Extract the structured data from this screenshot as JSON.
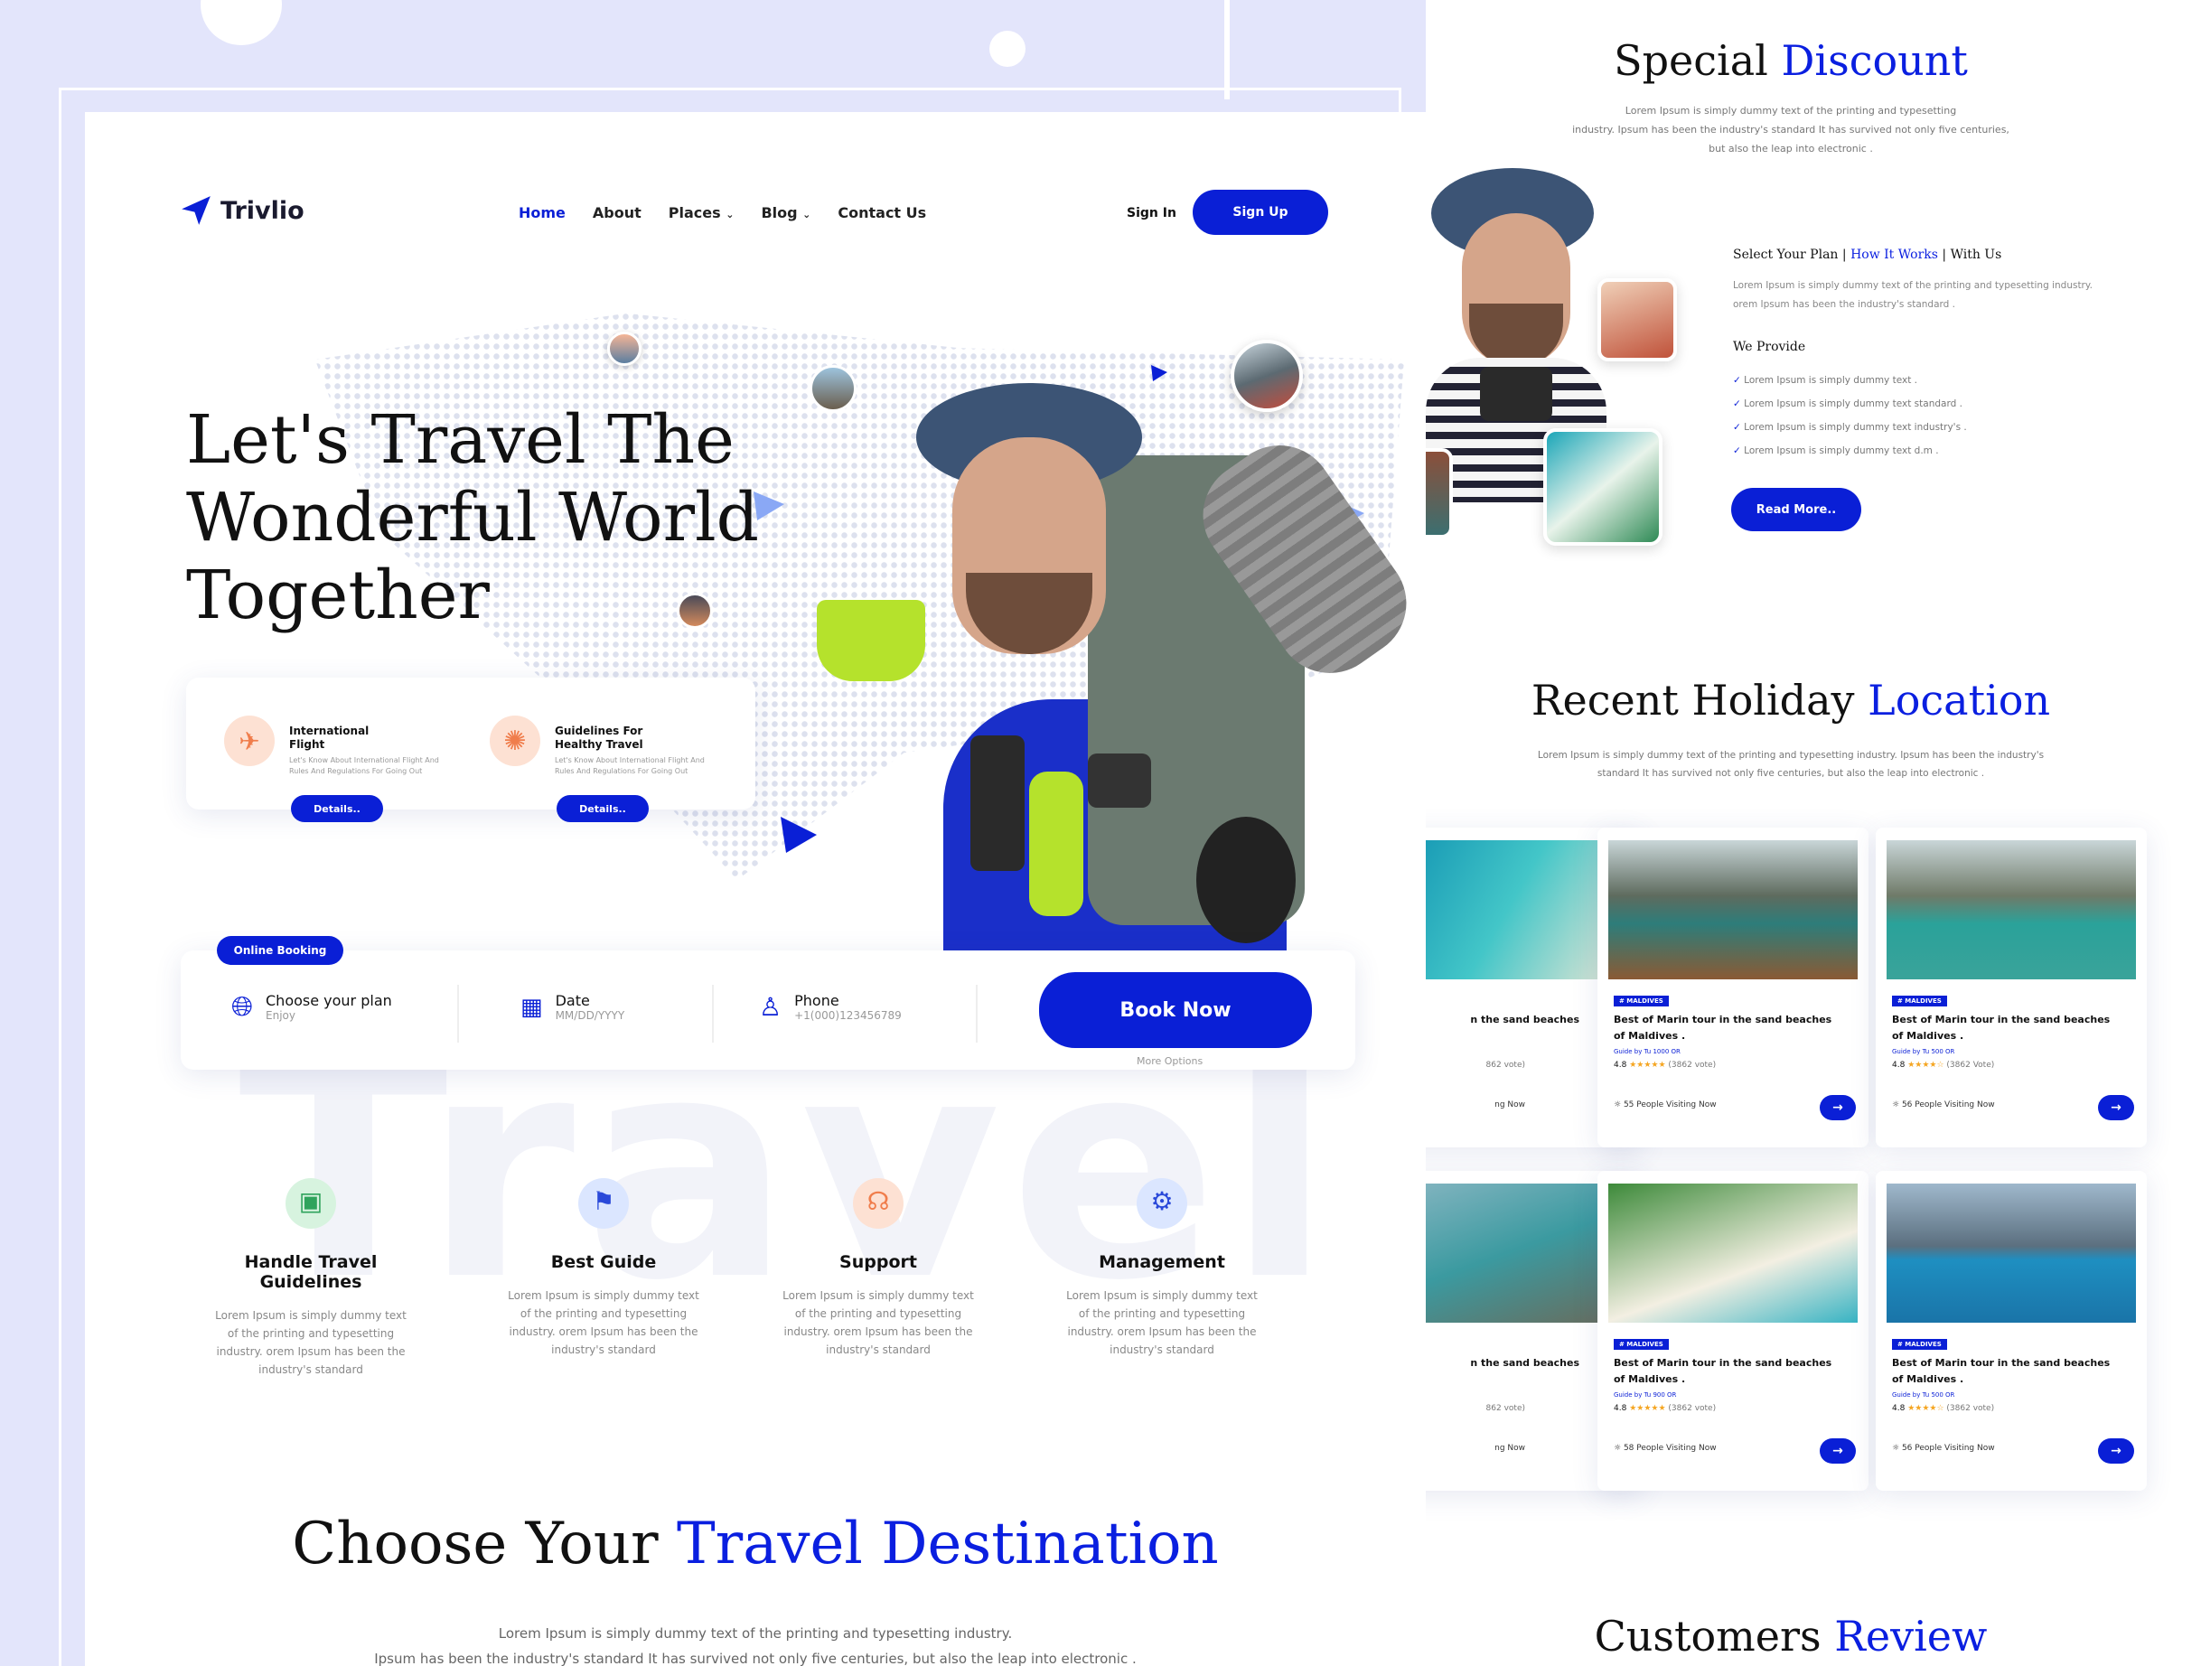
{
  "colors": {
    "accent": "#0a1fd6",
    "background": "#e3e5fb"
  },
  "header": {
    "logo_text": "Trivlio",
    "nav": [
      "Home",
      "About",
      "Places",
      "Blog",
      "Contact Us"
    ],
    "sign_in": "Sign In",
    "sign_up": "Sign Up"
  },
  "hero": {
    "title_1": "Let's Travel The",
    "title_2": "Wonderful World",
    "title_3": "Together",
    "features": [
      {
        "title_1": "International",
        "title_2": "Flight",
        "desc": "Let's Know About International Flight And Rules And Regulations For Going Out",
        "button": "Details.."
      },
      {
        "title_1": "Guidelines For",
        "title_2": "Healthy Travel",
        "desc": "Let's Know About International Flight And Rules And Regulations For Going Out",
        "button": "Details.."
      }
    ]
  },
  "booking": {
    "tag": "Online Booking",
    "plan_label": "Choose your plan",
    "plan_value": "Enjoy",
    "date_label": "Date",
    "date_value": "MM/DD/YYYY",
    "phone_label": "Phone",
    "phone_value": "+1(000)123456789",
    "book_button": "Book Now",
    "more": "More Options"
  },
  "watermark": "Travel",
  "services": [
    {
      "title": "Handle Travel Guidelines",
      "icon": "map-guide-icon",
      "l1": "Lorem Ipsum is simply dummy text",
      "l2": "of the printing and typesetting",
      "l3": "industry. orem Ipsum has been the",
      "l4": "industry's standard"
    },
    {
      "title": "Best Guide",
      "icon": "guide-icon",
      "l1": "Lorem Ipsum is simply dummy text",
      "l2": "of the printing and typesetting",
      "l3": "industry. orem Ipsum has been the",
      "l4": "industry's standard"
    },
    {
      "title": "Support",
      "icon": "headset-icon",
      "l1": "Lorem Ipsum is simply dummy text",
      "l2": "of the printing and typesetting",
      "l3": "industry. orem Ipsum has been the",
      "l4": "industry's standard"
    },
    {
      "title": "Management",
      "icon": "management-icon",
      "l1": "Lorem Ipsum is simply dummy text",
      "l2": "of the printing and typesetting",
      "l3": "industry. orem Ipsum has been the",
      "l4": "industry's standard"
    }
  ],
  "destination": {
    "title_a": "Choose Your",
    "title_b": "Travel Destination",
    "line1": "Lorem Ipsum is simply dummy text of the printing and typesetting industry.",
    "line2": "Ipsum has been the industry's standard  It has survived not only five centuries, but also the leap into electronic ."
  },
  "discount": {
    "title_a": "Special",
    "title_b": "Discount",
    "line1": "Lorem Ipsum is simply dummy text of the printing and typesetting",
    "line2": "industry. Ipsum has been the industry's standard  It has survived not only five centuries,",
    "line3": "but also the leap into electronic .",
    "plan_a": "Select Your Plan |",
    "plan_b": "How It Works",
    "plan_c": "| With Us",
    "plan_l1": "Lorem Ipsum is simply dummy text of the printing and typesetting industry.",
    "plan_l2": "orem Ipsum has been the industry's standard .",
    "provide_title": "We Provide",
    "provide": [
      "Lorem Ipsum is simply dummy text .",
      "Lorem Ipsum is simply dummy text standard .",
      "Lorem Ipsum is simply dummy text  industry's .",
      "Lorem Ipsum is simply dummy text d.m ."
    ],
    "read_more": "Read More.."
  },
  "holiday": {
    "title_a": "Recent Holiday",
    "title_b": "Location",
    "line1": "Lorem Ipsum is simply dummy text of the printing and typesetting industry. Ipsum has been the industry's",
    "line2": "standard  It has survived not only five centuries, but also the leap into electronic .",
    "cards": [
      {
        "badge": "",
        "title_1": "n the sand beaches",
        "title_2": "",
        "by": "",
        "rating": "",
        "stars": "",
        "votes": "862 vote)",
        "visiting": "ng Now"
      },
      {
        "badge": "# MALDIVES",
        "title_1": "Best of Marin tour in the sand beaches",
        "title_2": "of Maldives .",
        "by": "Guide by Tu 1000 OR",
        "rating": "4.8",
        "stars": "★★★★★",
        "votes": "(3862 vote)",
        "visiting": "55 People Visiting Now"
      },
      {
        "badge": "# MALDIVES",
        "title_1": "Best of Marin tour in the sand beaches",
        "title_2": "of Maldives .",
        "by": "Guide by Tu 500 OR",
        "rating": "4.8",
        "stars": "★★★★☆",
        "votes": "(3862 Vote)",
        "visiting": "56 People Visiting Now"
      },
      {
        "badge": "",
        "title_1": "n the sand beaches",
        "title_2": "",
        "by": "",
        "rating": "",
        "stars": "",
        "votes": "862 vote)",
        "visiting": "ng Now"
      },
      {
        "badge": "# MALDIVES",
        "title_1": "Best of Marin tour in the sand beaches",
        "title_2": "of Maldives .",
        "by": "Guide by Tu 900 OR",
        "rating": "4.8",
        "stars": "★★★★★",
        "votes": "(3862 vote)",
        "visiting": "58 People Visiting Now"
      },
      {
        "badge": "# MALDIVES",
        "title_1": "Best of Marin tour in the sand beaches",
        "title_2": "of Maldives .",
        "by": "Guide by Tu 500 OR",
        "rating": "4.8",
        "stars": "★★★★☆",
        "votes": "(3862 vote)",
        "visiting": "56 People Visiting Now"
      }
    ]
  },
  "reviews": {
    "title_a": "Customers",
    "title_b": "Review"
  }
}
